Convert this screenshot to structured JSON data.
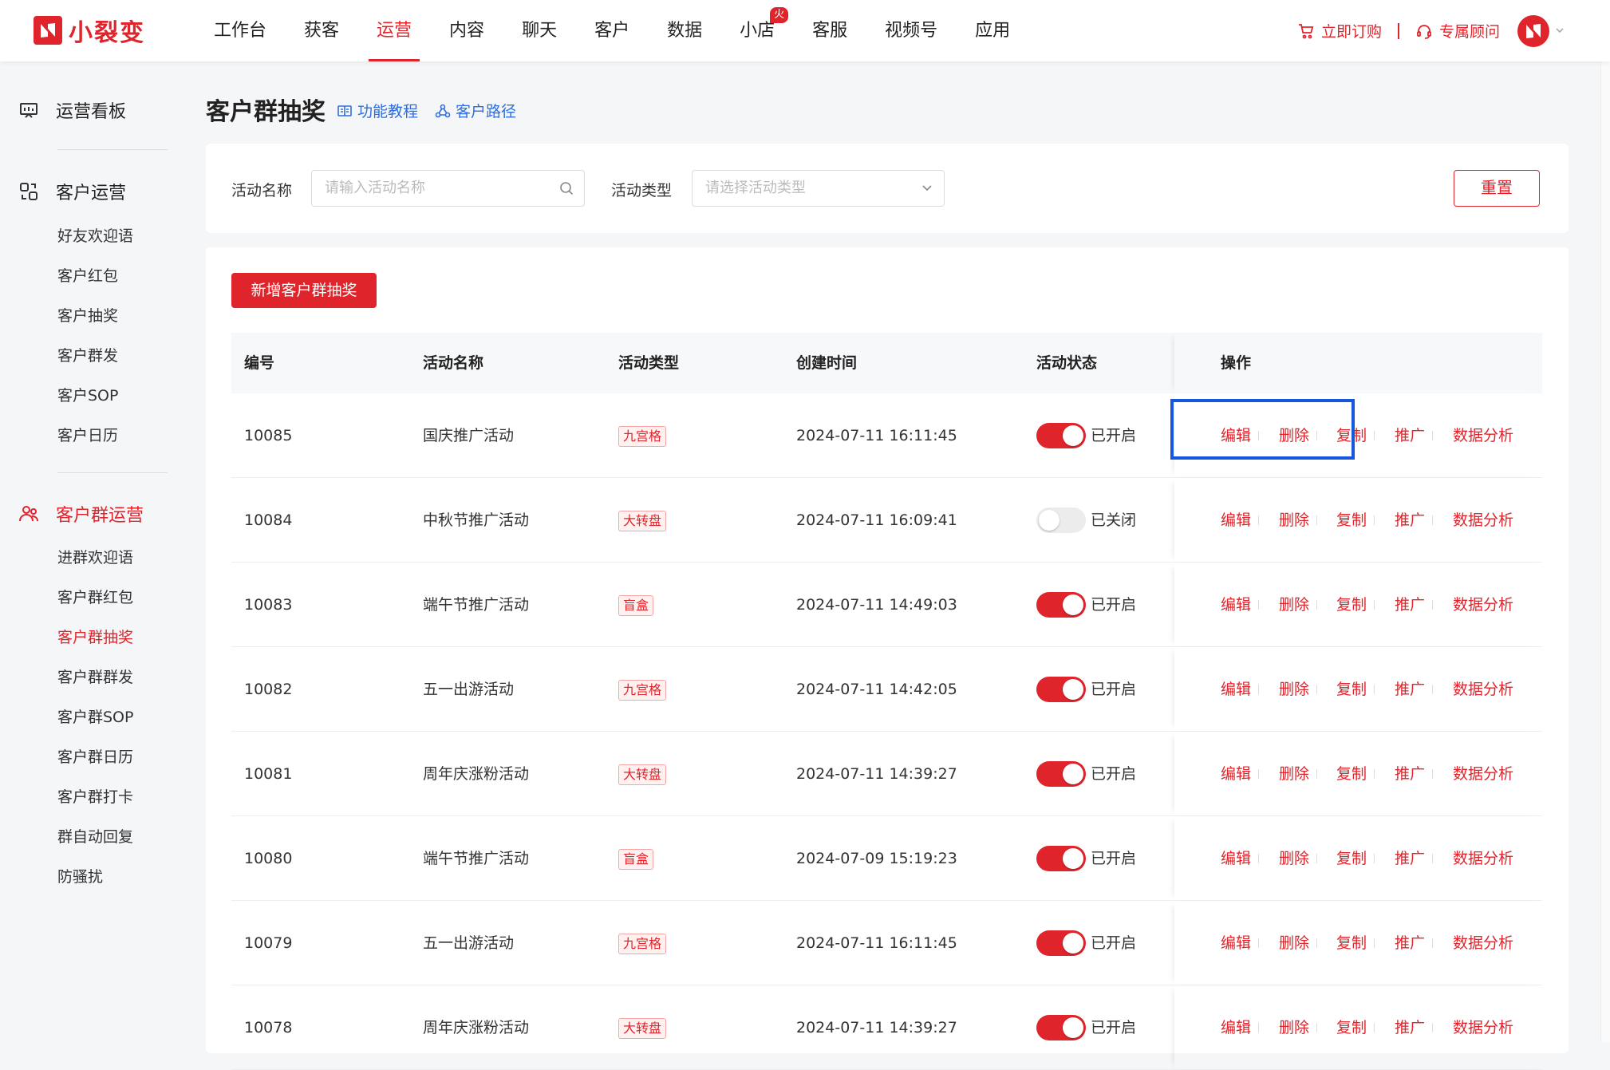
{
  "brand": {
    "name": "小裂变",
    "color": "#e0242b"
  },
  "nav": {
    "items": [
      {
        "label": "工作台",
        "active": false
      },
      {
        "label": "获客",
        "active": false
      },
      {
        "label": "运营",
        "active": true
      },
      {
        "label": "内容",
        "active": false
      },
      {
        "label": "聊天",
        "active": false
      },
      {
        "label": "客户",
        "active": false
      },
      {
        "label": "数据",
        "active": false
      },
      {
        "label": "小店",
        "active": false,
        "badge": "火爆"
      },
      {
        "label": "客服",
        "active": false
      },
      {
        "label": "视频号",
        "active": false
      },
      {
        "label": "应用",
        "active": false
      }
    ],
    "buy_label": "立即订购",
    "advisor_label": "专属顾问"
  },
  "sidebar": {
    "dashboard": "运营看板",
    "customer_ops": {
      "title": "客户运营",
      "items": [
        "好友欢迎语",
        "客户红包",
        "客户抽奖",
        "客户群发",
        "客户SOP",
        "客户日历"
      ]
    },
    "group_ops": {
      "title": "客户群运营",
      "items": [
        "进群欢迎语",
        "客户群红包",
        "客户群抽奖",
        "客户群群发",
        "客户群SOP",
        "客户群日历",
        "客户群打卡",
        "群自动回复",
        "防骚扰"
      ],
      "active_index": 2
    }
  },
  "page": {
    "title": "客户群抽奖",
    "tutorial_link": "功能教程",
    "path_link": "客户路径"
  },
  "filters": {
    "name_label": "活动名称",
    "name_placeholder": "请输入活动名称",
    "type_label": "活动类型",
    "type_placeholder": "请选择活动类型",
    "reset_label": "重置"
  },
  "add_button": "新增客户群抽奖",
  "table": {
    "columns": [
      "编号",
      "活动名称",
      "活动类型",
      "创建时间",
      "活动状态",
      "操作"
    ],
    "actions": [
      "编辑",
      "删除",
      "复制",
      "推广",
      "数据分析"
    ],
    "rows": [
      {
        "id": "10085",
        "name": "国庆推广活动",
        "type": "九宫格",
        "created": "2024-07-11 16:11:45",
        "on": true,
        "status": "已开启"
      },
      {
        "id": "10084",
        "name": "中秋节推广活动",
        "type": "大转盘",
        "created": "2024-07-11 16:09:41",
        "on": false,
        "status": "已关闭"
      },
      {
        "id": "10083",
        "name": "端午节推广活动",
        "type": "盲盒",
        "created": "2024-07-11 14:49:03",
        "on": true,
        "status": "已开启"
      },
      {
        "id": "10082",
        "name": "五一出游活动",
        "type": "九宫格",
        "created": "2024-07-11 14:42:05",
        "on": true,
        "status": "已开启"
      },
      {
        "id": "10081",
        "name": "周年庆涨粉活动",
        "type": "大转盘",
        "created": "2024-07-11 14:39:27",
        "on": true,
        "status": "已开启"
      },
      {
        "id": "10080",
        "name": "端午节推广活动",
        "type": "盲盒",
        "created": "2024-07-09 15:19:23",
        "on": true,
        "status": "已开启"
      },
      {
        "id": "10079",
        "name": "五一出游活动",
        "type": "九宫格",
        "created": "2024-07-11 16:11:45",
        "on": true,
        "status": "已开启"
      },
      {
        "id": "10078",
        "name": "周年庆涨粉活动",
        "type": "大转盘",
        "created": "2024-07-11 14:39:27",
        "on": true,
        "status": "已开启"
      }
    ]
  },
  "highlight_color": "#1757e0"
}
